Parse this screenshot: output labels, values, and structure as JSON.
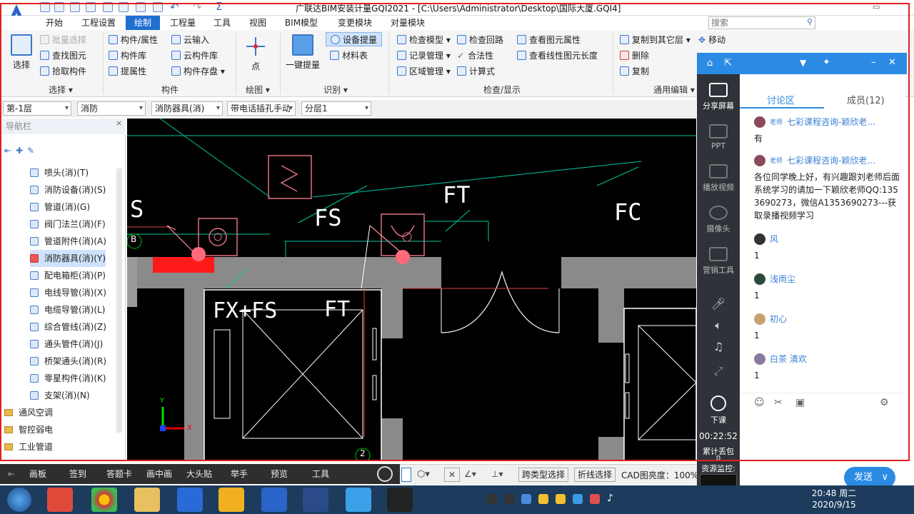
{
  "window": {
    "title": "广联达BIM安装计量GQI2021 - [C:\\Users\\Administrator\\Desktop\\国际大厦.GQI4]",
    "search_placeholder": "搜索"
  },
  "menu_tabs": [
    "开始",
    "工程设置",
    "绘制",
    "工程量",
    "工具",
    "视图",
    "BIM模型",
    "变更模块",
    "对量模块"
  ],
  "ribbon": {
    "select": {
      "label": "选择",
      "batch": "批量选择",
      "find": "查找图元",
      "pick": "拾取构件",
      "group": "选择"
    },
    "component": {
      "prop": "构件/属性",
      "lib": "构件库",
      "extract": "提属性",
      "cloud_in": "云输入",
      "cloud_lib": "云构件库",
      "store": "构件存盘",
      "group": "构件"
    },
    "draw": {
      "point": "点",
      "group": "绘图"
    },
    "identify": {
      "one_click": "一键提量",
      "device": "设备提量",
      "material": "材料表",
      "group": "识别"
    },
    "check": {
      "model": "检查模型",
      "loop": "检查回路",
      "view_prop": "查看图元属性",
      "record": "记录管理",
      "legal": "合法性",
      "line_len": "查看线性图元长度",
      "region": "区域管理",
      "formula": "计算式",
      "group": "检查/显示"
    },
    "edit": {
      "copy_to": "复制到其它层",
      "move": "移动",
      "delete": "删除",
      "copy": "复制",
      "group": "通用编辑"
    }
  },
  "dropdowns": [
    "第-1层",
    "消防",
    "消防器具(消)",
    "带电话插孔手动",
    "分层1"
  ],
  "nav": {
    "title": "导航栏",
    "items": [
      "喷头(消)(T)",
      "消防设备(消)(S)",
      "管道(消)(G)",
      "阀门法兰(消)(F)",
      "管道附件(消)(A)",
      "消防器具(消)(Y)",
      "配电箱柜(消)(P)",
      "电线导管(消)(X)",
      "电缆导管(消)(L)",
      "综合管线(消)(Z)",
      "通头管件(消)(J)",
      "桥架通头(消)(R)",
      "零星构件(消)(K)",
      "支架(消)(N)"
    ],
    "folders": [
      "通风空调",
      "智控弱电",
      "工业管道"
    ]
  },
  "canvas_labels": [
    "FS",
    "FT",
    "FC",
    "S",
    "B",
    "FX+FS",
    "FT",
    "2",
    "Y",
    "X"
  ],
  "class_toolbar": [
    "画板",
    "签到",
    "答题卡",
    "画中画",
    "大头贴",
    "举手",
    "预览",
    "工具"
  ],
  "cad_bar": {
    "type_select": "跨类型选择",
    "polyline_select": "折线选择",
    "cad_width_label": "CAD图亮度：",
    "cad_width_value": "100%"
  },
  "classroom": {
    "tabs": {
      "discussion": "讨论区",
      "members": "成员(12)"
    },
    "side": [
      "分享屏幕",
      "PPT",
      "播放视频",
      "摄像头",
      "营销工具",
      "下课"
    ],
    "timer": "00:22:52",
    "lost_packets_label": "累计丢包",
    "lost_packets": "0",
    "monitor_label": "资源监控:",
    "send": "发送",
    "messages": [
      {
        "role": "老师",
        "name": "七彩课程咨询-颖欣老...",
        "text": "有"
      },
      {
        "role": "老师",
        "name": "七彩课程咨询-颖欣老...",
        "text": "各位同学晚上好，有兴趣跟刘老师后面系统学习的请加一下颖欣老师QQ:1353690273，微信A1353690273---获取录播视频学习"
      },
      {
        "role": "",
        "name": "风",
        "text": "1"
      },
      {
        "role": "",
        "name": "浅雨尘",
        "text": "1"
      },
      {
        "role": "",
        "name": "初心",
        "text": "1"
      },
      {
        "role": "",
        "name": "白茶 清欢",
        "text": "1"
      }
    ]
  },
  "taskbar": {
    "time": "20:48 周二",
    "date": "2020/9/15"
  }
}
